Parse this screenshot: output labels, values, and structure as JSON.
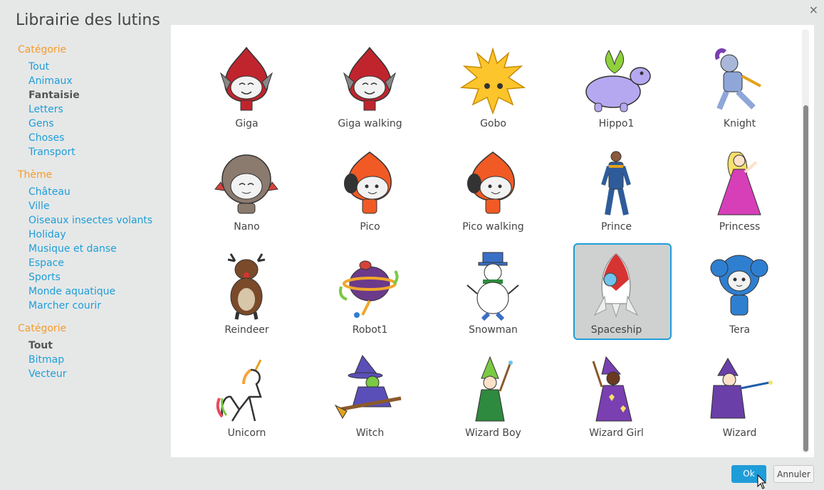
{
  "dialog": {
    "title": "Librairie des lutins",
    "close_glyph": "×"
  },
  "sidebar": {
    "sections": [
      {
        "heading": "Catégorie",
        "items": [
          {
            "label": "Tout",
            "selected": false
          },
          {
            "label": "Animaux",
            "selected": false
          },
          {
            "label": "Fantaisie",
            "selected": true
          },
          {
            "label": "Letters",
            "selected": false
          },
          {
            "label": "Gens",
            "selected": false
          },
          {
            "label": "Choses",
            "selected": false
          },
          {
            "label": "Transport",
            "selected": false
          }
        ]
      },
      {
        "heading": "Thème",
        "items": [
          {
            "label": "Château",
            "selected": false
          },
          {
            "label": "Ville",
            "selected": false
          },
          {
            "label": "Oiseaux insectes volants",
            "selected": false
          },
          {
            "label": "Holiday",
            "selected": false
          },
          {
            "label": "Musique et danse",
            "selected": false
          },
          {
            "label": "Espace",
            "selected": false
          },
          {
            "label": "Sports",
            "selected": false
          },
          {
            "label": "Monde aquatique",
            "selected": false
          },
          {
            "label": "Marcher courir",
            "selected": false
          }
        ]
      },
      {
        "heading": "Catégorie",
        "items": [
          {
            "label": "Tout",
            "selected": true
          },
          {
            "label": "Bitmap",
            "selected": false
          },
          {
            "label": "Vecteur",
            "selected": false
          }
        ]
      }
    ]
  },
  "sprites": [
    {
      "name": "Giga",
      "icon": "giga-sprite-icon",
      "color": "#c0252e",
      "selected": false
    },
    {
      "name": "Giga walking",
      "icon": "giga-walking-sprite-icon",
      "color": "#c0252e",
      "selected": false
    },
    {
      "name": "Gobo",
      "icon": "gobo-sprite-icon",
      "color": "#fcc52c",
      "selected": false
    },
    {
      "name": "Hippo1",
      "icon": "hippo-sprite-icon",
      "color": "#b6a8f0",
      "selected": false
    },
    {
      "name": "Knight",
      "icon": "knight-sprite-icon",
      "color": "#8fa6d8",
      "selected": false
    },
    {
      "name": "Nano",
      "icon": "nano-sprite-icon",
      "color": "#8b7a6e",
      "selected": false
    },
    {
      "name": "Pico",
      "icon": "pico-sprite-icon",
      "color": "#f15a24",
      "selected": false
    },
    {
      "name": "Pico walking",
      "icon": "pico-walking-sprite-icon",
      "color": "#f15a24",
      "selected": false
    },
    {
      "name": "Prince",
      "icon": "prince-sprite-icon",
      "color": "#2e5c9a",
      "selected": false
    },
    {
      "name": "Princess",
      "icon": "princess-sprite-icon",
      "color": "#d63fb8",
      "selected": false
    },
    {
      "name": "Reindeer",
      "icon": "reindeer-sprite-icon",
      "color": "#7a4a2a",
      "selected": false
    },
    {
      "name": "Robot1",
      "icon": "robot-sprite-icon",
      "color": "#6b3a8a",
      "selected": false
    },
    {
      "name": "Snowman",
      "icon": "snowman-sprite-icon",
      "color": "#3a6fc6",
      "selected": false
    },
    {
      "name": "Spaceship",
      "icon": "spaceship-sprite-icon",
      "color": "#d63333",
      "selected": true
    },
    {
      "name": "Tera",
      "icon": "tera-sprite-icon",
      "color": "#2f7fd0",
      "selected": false
    },
    {
      "name": "Unicorn",
      "icon": "unicorn-sprite-icon",
      "color": "#f0f0f0",
      "selected": false
    },
    {
      "name": "Witch",
      "icon": "witch-sprite-icon",
      "color": "#5a4fb8",
      "selected": false
    },
    {
      "name": "Wizard Boy",
      "icon": "wizard-boy-sprite-icon",
      "color": "#2e8a3e",
      "selected": false
    },
    {
      "name": "Wizard Girl",
      "icon": "wizard-girl-sprite-icon",
      "color": "#7a3fb0",
      "selected": false
    },
    {
      "name": "Wizard",
      "icon": "wizard-sprite-icon",
      "color": "#6a3fa8",
      "selected": false
    }
  ],
  "buttons": {
    "ok_label": "Ok",
    "cancel_label": "Annuler"
  },
  "colors": {
    "accent": "#1f9dd8",
    "heading": "#f59b2a"
  }
}
